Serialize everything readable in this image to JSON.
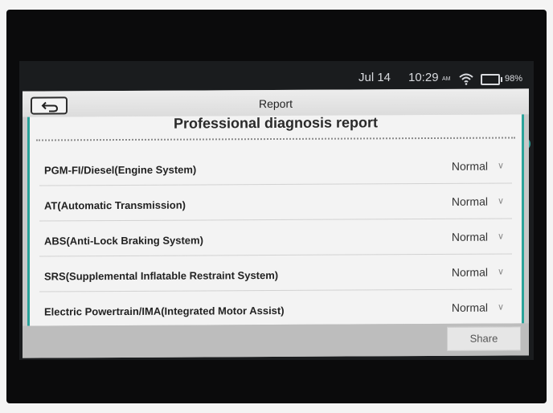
{
  "status_bar": {
    "date": "Jul 14",
    "time": "10:29",
    "ampm": "AM",
    "battery": "98%",
    "wifi_icon": "wifi-icon",
    "battery_icon": "battery-icon"
  },
  "titlebar": {
    "back_icon": "back-arrow-icon",
    "title": "Report"
  },
  "report": {
    "heading": "Professional diagnosis report",
    "items": [
      {
        "label": "PGM-FI/Diesel(Engine System)",
        "status": "Normal"
      },
      {
        "label": "AT(Automatic Transmission)",
        "status": "Normal"
      },
      {
        "label": "ABS(Anti-Lock Braking System)",
        "status": "Normal"
      },
      {
        "label": "SRS(Supplemental Inflatable Restraint System)",
        "status": "Normal"
      },
      {
        "label": "Electric Powertrain/IMA(Integrated Motor Assist)",
        "status": "Normal"
      }
    ]
  },
  "footer": {
    "share_label": "Share"
  },
  "colors": {
    "accent": "#2aa39a",
    "bezel": "#0b0b0c"
  }
}
